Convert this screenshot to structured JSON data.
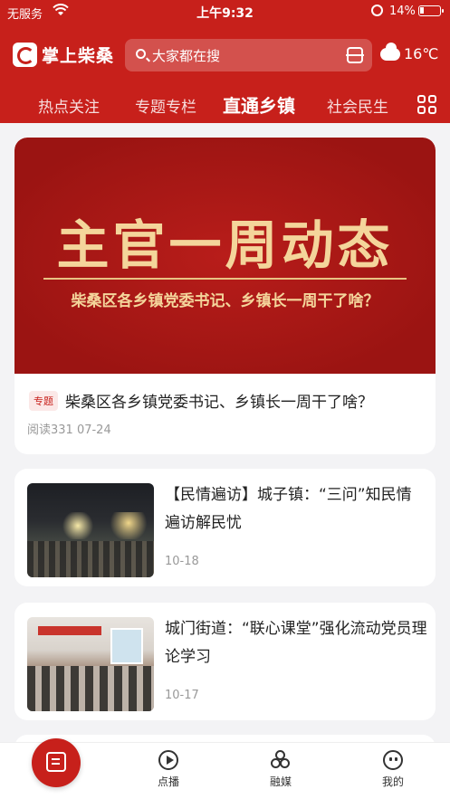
{
  "status_bar": {
    "carrier": "无服务",
    "time": "上午9:32",
    "battery_percent": "14%"
  },
  "header": {
    "app_name": "掌上柴桑",
    "search_placeholder": "大家都在搜",
    "weather_temp": "16℃",
    "icons": [
      "search-icon",
      "scan-icon",
      "cloud-icon"
    ]
  },
  "tabs": [
    {
      "label": "热点关注",
      "active": false
    },
    {
      "label": "专题专栏",
      "active": false
    },
    {
      "label": "直通乡镇",
      "active": true
    },
    {
      "label": "社会民生",
      "active": false
    }
  ],
  "feature": {
    "banner_headline": "主官一周动态",
    "banner_subtitle": "柴桑区各乡镇党委书记、乡镇长一周干了啥？",
    "tag": "专题",
    "title": "柴桑区各乡镇党委书记、乡镇长一周干了啥？",
    "meta": "阅读331  07-24"
  },
  "news": [
    {
      "title": "【民情遍访】城子镇：“三问”知民情 遍访解民忧",
      "date": "10-18"
    },
    {
      "title": "城门街道：“联心课堂”强化流动党员理论学习",
      "date": "10-17"
    }
  ],
  "bottom_nav": [
    {
      "label": "",
      "icon": "article-icon",
      "active": true
    },
    {
      "label": "点播",
      "icon": "play-icon",
      "active": false
    },
    {
      "label": "融媒",
      "icon": "media-icon",
      "active": false
    },
    {
      "label": "我的",
      "icon": "profile-icon",
      "active": false
    }
  ],
  "colors": {
    "brand": "#c7201b",
    "banner_gold": "#f4d59b",
    "meta_gray": "#999999"
  }
}
